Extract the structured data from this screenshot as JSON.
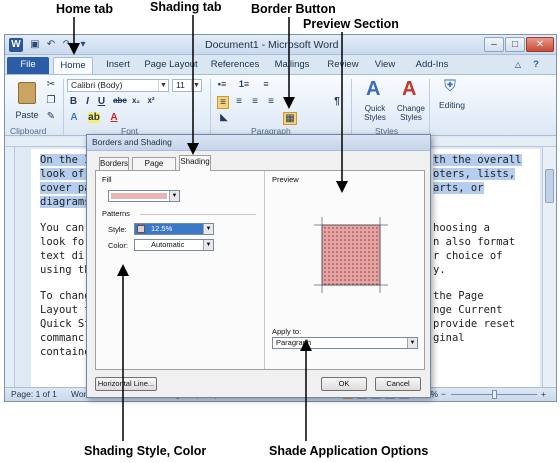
{
  "annotations": {
    "home_tab": "Home tab",
    "shading_tab": "Shading tab",
    "border_button": "Border Button",
    "preview_section": "Preview Section",
    "shading_style_color": "Shading Style, Color",
    "shade_application": "Shade Application Options"
  },
  "window": {
    "title": "Document1 - Microsoft Word",
    "word_icon": "W",
    "quick_access": [
      "save-icon",
      "undo-icon",
      "redo-icon"
    ]
  },
  "tabs": [
    "File",
    "Home",
    "Insert",
    "Page Layout",
    "References",
    "Mailings",
    "Review",
    "View",
    "Add-Ins"
  ],
  "ribbon": {
    "paste_label": "Paste",
    "font_name": "Calibri (Body)",
    "font_size": "11",
    "clipboard_label": "Clipboard",
    "font_label": "Font",
    "paragraph_label": "Paragraph",
    "styles_label": "Styles",
    "quick_styles_label": "Quick Styles",
    "change_styles_label": "Change Styles",
    "editing_label": "Editing"
  },
  "document": {
    "lines": [
      {
        "text": "On the In",
        "tail": "th the overall",
        "highlight": true
      },
      {
        "text": "look of yo",
        "tail": "oters, lists,",
        "highlight": true
      },
      {
        "text": "cover pag",
        "tail": "arts, or",
        "highlight": true
      },
      {
        "text": "diagrams",
        "tail": "",
        "highlight": true
      },
      {
        "text": "You can e",
        "tail": "hoosing a",
        "highlight": false
      },
      {
        "text": "look for t",
        "tail": "n also format",
        "highlight": false
      },
      {
        "text": "text direc",
        "tail": "r choice of",
        "highlight": false
      },
      {
        "text": "using the",
        "tail": "y.",
        "highlight": false
      },
      {
        "text": "To chang",
        "tail": "the Page",
        "highlight": false
      },
      {
        "text": "Layout ta",
        "tail": "nge Current",
        "highlight": false
      },
      {
        "text": "Quick Sty",
        "tail": "provide reset",
        "highlight": false
      },
      {
        "text": "commanc",
        "tail": "ginal",
        "highlight": false
      },
      {
        "text": "containe",
        "tail": "",
        "highlight": false
      }
    ]
  },
  "status": {
    "page": "Page: 1 of 1",
    "words": "Words: 53/185",
    "language": "English (U.S.)",
    "mode": "Insert",
    "zoom": "110%",
    "zoom_minus": "−",
    "zoom_plus": "+"
  },
  "dialog": {
    "title": "Borders and Shading",
    "tabs": [
      "Borders",
      "Page Border",
      "Shading"
    ],
    "active_tab": "Shading",
    "fill_label": "Fill",
    "fill_color": "#e8b4b4",
    "patterns_label": "Patterns",
    "style_label": "Style:",
    "style_value": "12.5%",
    "color_label": "Color:",
    "color_value": "Automatic",
    "preview_label": "Preview",
    "apply_to_label": "Apply to:",
    "apply_to_value": "Paragraph",
    "horizontal_line_label": "Horizontal Line...",
    "ok_label": "OK",
    "cancel_label": "Cancel"
  }
}
